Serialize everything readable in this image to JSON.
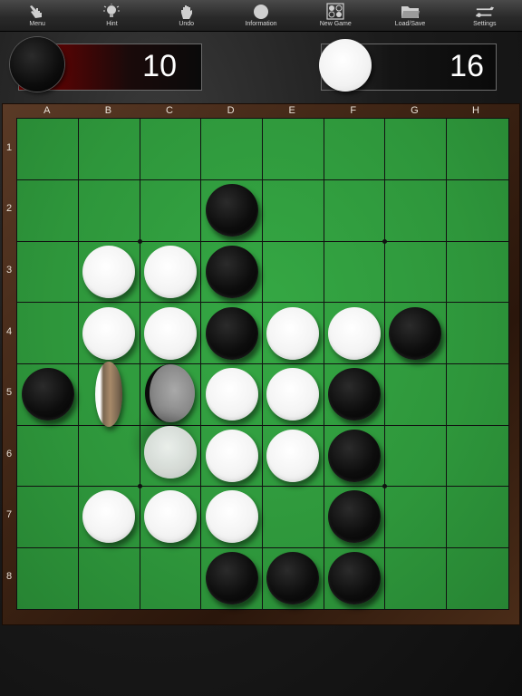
{
  "toolbar": {
    "items": [
      {
        "label": "Menu",
        "icon": "hand-pointing-icon"
      },
      {
        "label": "Hint",
        "icon": "lightbulb-icon"
      },
      {
        "label": "Undo",
        "icon": "hand-stop-icon"
      },
      {
        "label": "Information",
        "icon": "info-circle-icon"
      },
      {
        "label": "New Game",
        "icon": "new-game-grid-icon"
      },
      {
        "label": "Load/Save",
        "icon": "folder-icon"
      },
      {
        "label": "Settings",
        "icon": "wrench-icon"
      }
    ]
  },
  "scores": {
    "black": "10",
    "white": "16"
  },
  "board": {
    "columns": [
      "A",
      "B",
      "C",
      "D",
      "E",
      "F",
      "G",
      "H"
    ],
    "rows": [
      "1",
      "2",
      "3",
      "4",
      "5",
      "6",
      "7",
      "8"
    ],
    "colors": {
      "felt": "#2f9a3c",
      "frame": "#3e2414",
      "black_disc": "#0d0d0d",
      "white_disc": "#f4f4f4"
    },
    "discs": [
      {
        "cell": "D2",
        "color": "black"
      },
      {
        "cell": "B3",
        "color": "white"
      },
      {
        "cell": "C3",
        "color": "white"
      },
      {
        "cell": "D3",
        "color": "black"
      },
      {
        "cell": "B4",
        "color": "white"
      },
      {
        "cell": "C4",
        "color": "white"
      },
      {
        "cell": "D4",
        "color": "black"
      },
      {
        "cell": "E4",
        "color": "white"
      },
      {
        "cell": "F4",
        "color": "white"
      },
      {
        "cell": "G4",
        "color": "black"
      },
      {
        "cell": "A5",
        "color": "black"
      },
      {
        "cell": "B5",
        "color": "flipping"
      },
      {
        "cell": "C5",
        "color": "flipping"
      },
      {
        "cell": "D5",
        "color": "white"
      },
      {
        "cell": "E5",
        "color": "white"
      },
      {
        "cell": "F5",
        "color": "black"
      },
      {
        "cell": "C6",
        "color": "white-placed"
      },
      {
        "cell": "D6",
        "color": "white"
      },
      {
        "cell": "E6",
        "color": "white"
      },
      {
        "cell": "F6",
        "color": "black"
      },
      {
        "cell": "B7",
        "color": "white"
      },
      {
        "cell": "C7",
        "color": "white"
      },
      {
        "cell": "D7",
        "color": "white"
      },
      {
        "cell": "F7",
        "color": "black"
      },
      {
        "cell": "D8",
        "color": "black"
      },
      {
        "cell": "E8",
        "color": "black"
      },
      {
        "cell": "F8",
        "color": "black"
      }
    ]
  }
}
